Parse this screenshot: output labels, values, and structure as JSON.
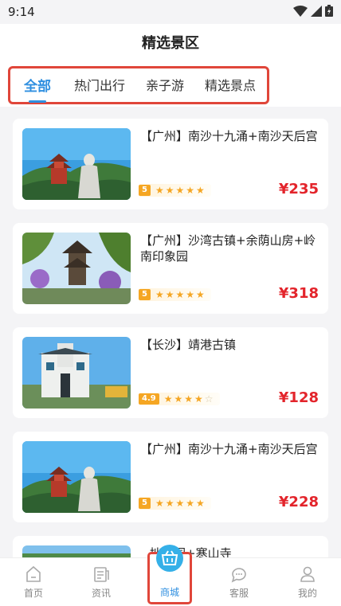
{
  "status_bar": {
    "time": "9:14",
    "icons": [
      "wifi-icon",
      "signal-icon",
      "battery-icon"
    ]
  },
  "header": {
    "title": "精选景区"
  },
  "tabs": [
    {
      "label": "全部",
      "active": true
    },
    {
      "label": "热门出行",
      "active": false
    },
    {
      "label": "亲子游",
      "active": false
    },
    {
      "label": "精选景点",
      "active": false
    }
  ],
  "products": [
    {
      "name": "【广州】南沙十九涌+南沙天后宫",
      "score": "5",
      "stars": 5,
      "price": "¥235"
    },
    {
      "name": "【广州】沙湾古镇+余荫山房+岭南印象园",
      "score": "5",
      "stars": 5,
      "price": "¥318"
    },
    {
      "name": "【长沙】靖港古镇",
      "score": "4.9",
      "stars": 4,
      "price": "¥128"
    },
    {
      "name": "【广州】南沙十九涌+南沙天后宫",
      "score": "5",
      "stars": 5,
      "price": "¥228"
    },
    {
      "name": "拙政园+寒山寺"
    }
  ],
  "bottom_nav": [
    {
      "label": "首页",
      "icon": "home-icon"
    },
    {
      "label": "资讯",
      "icon": "news-icon"
    },
    {
      "label": "商城",
      "icon": "shop-basket-icon",
      "active": true
    },
    {
      "label": "客服",
      "icon": "chat-icon"
    },
    {
      "label": "我的",
      "icon": "user-icon"
    }
  ],
  "colors": {
    "accent": "#2f8fe0",
    "price": "#e3242b",
    "star": "#f5a623",
    "highlight_frame": "#e0463a"
  }
}
